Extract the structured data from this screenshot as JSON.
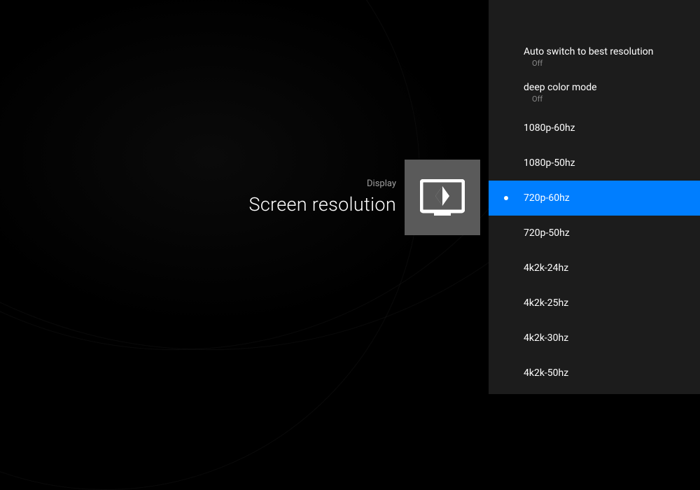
{
  "header": {
    "category": "Display",
    "title": "Screen resolution"
  },
  "sidebar": {
    "toggles": [
      {
        "label": "Auto switch to best resolution",
        "value": "Off"
      },
      {
        "label": "deep color mode",
        "value": "Off"
      }
    ],
    "options": [
      {
        "label": "1080p-60hz",
        "selected": false
      },
      {
        "label": "1080p-50hz",
        "selected": false
      },
      {
        "label": "720p-60hz",
        "selected": true
      },
      {
        "label": "720p-50hz",
        "selected": false
      },
      {
        "label": "4k2k-24hz",
        "selected": false
      },
      {
        "label": "4k2k-25hz",
        "selected": false
      },
      {
        "label": "4k2k-30hz",
        "selected": false
      },
      {
        "label": "4k2k-50hz",
        "selected": false
      }
    ]
  }
}
